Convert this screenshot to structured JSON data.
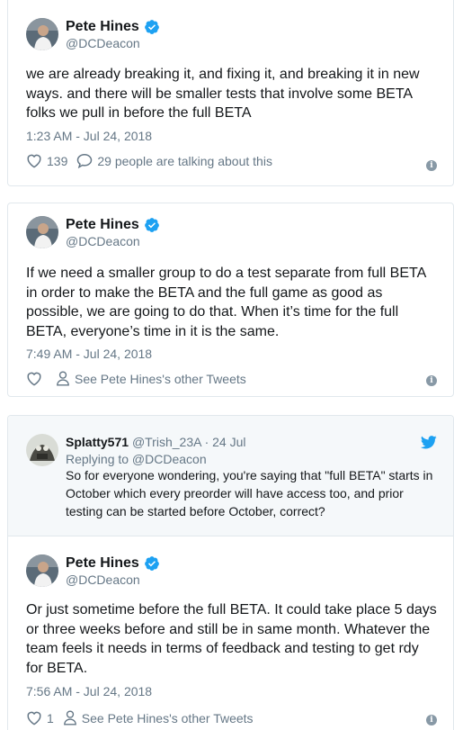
{
  "tweets": [
    {
      "author_name": "Pete Hines",
      "handle": "@DCDeacon",
      "text": "we are already breaking it, and fixing it, and breaking it in new ways. and there will be smaller tests that involve some BETA folks we pull in before the full BETA",
      "timestamp": "1:23 AM - Jul 24, 2018",
      "likes": "139",
      "talking": "29 people are talking about this"
    },
    {
      "author_name": "Pete Hines",
      "handle": "@DCDeacon",
      "text": "If we need a smaller group to do a test separate from full BETA in order to make the BETA and the full game as good as possible, we are going to do that. When it’s time for the full BETA, everyone’s time in it is the same.",
      "timestamp": "7:49 AM - Jul 24, 2018",
      "likes": "",
      "other_tweets": "See Pete Hines's other Tweets"
    },
    {
      "quoted": {
        "author_name": "Splatty571",
        "handle": "@Trish_23A",
        "date": "· 24 Jul",
        "replying_to": "Replying to @DCDeacon",
        "text": "So for everyone wondering, you're saying that \"full BETA\" starts in October which every preorder will have access too, and prior testing can be started before October, correct?"
      },
      "author_name": "Pete Hines",
      "handle": "@DCDeacon",
      "text": "Or just sometime before the full BETA. It could take place 5 days or three weeks before and still be in same month. Whatever the team feels it needs in terms of feedback and testing to get rdy for BETA.",
      "timestamp": "7:56 AM - Jul 24, 2018",
      "likes": "1",
      "other_tweets": "See Pete Hines's other Tweets"
    }
  ],
  "icons": {
    "verified": "verified-badge-icon",
    "heart": "heart-icon",
    "comment": "speech-bubble-icon",
    "person": "person-icon",
    "info": "info-icon",
    "bird": "twitter-bird-icon"
  },
  "colors": {
    "brand_blue": "#1da1f2",
    "muted": "#657786",
    "text": "#14171a",
    "border": "#e1e8ed",
    "quoted_bg": "#f5f8fa"
  },
  "info_glyph": "i"
}
